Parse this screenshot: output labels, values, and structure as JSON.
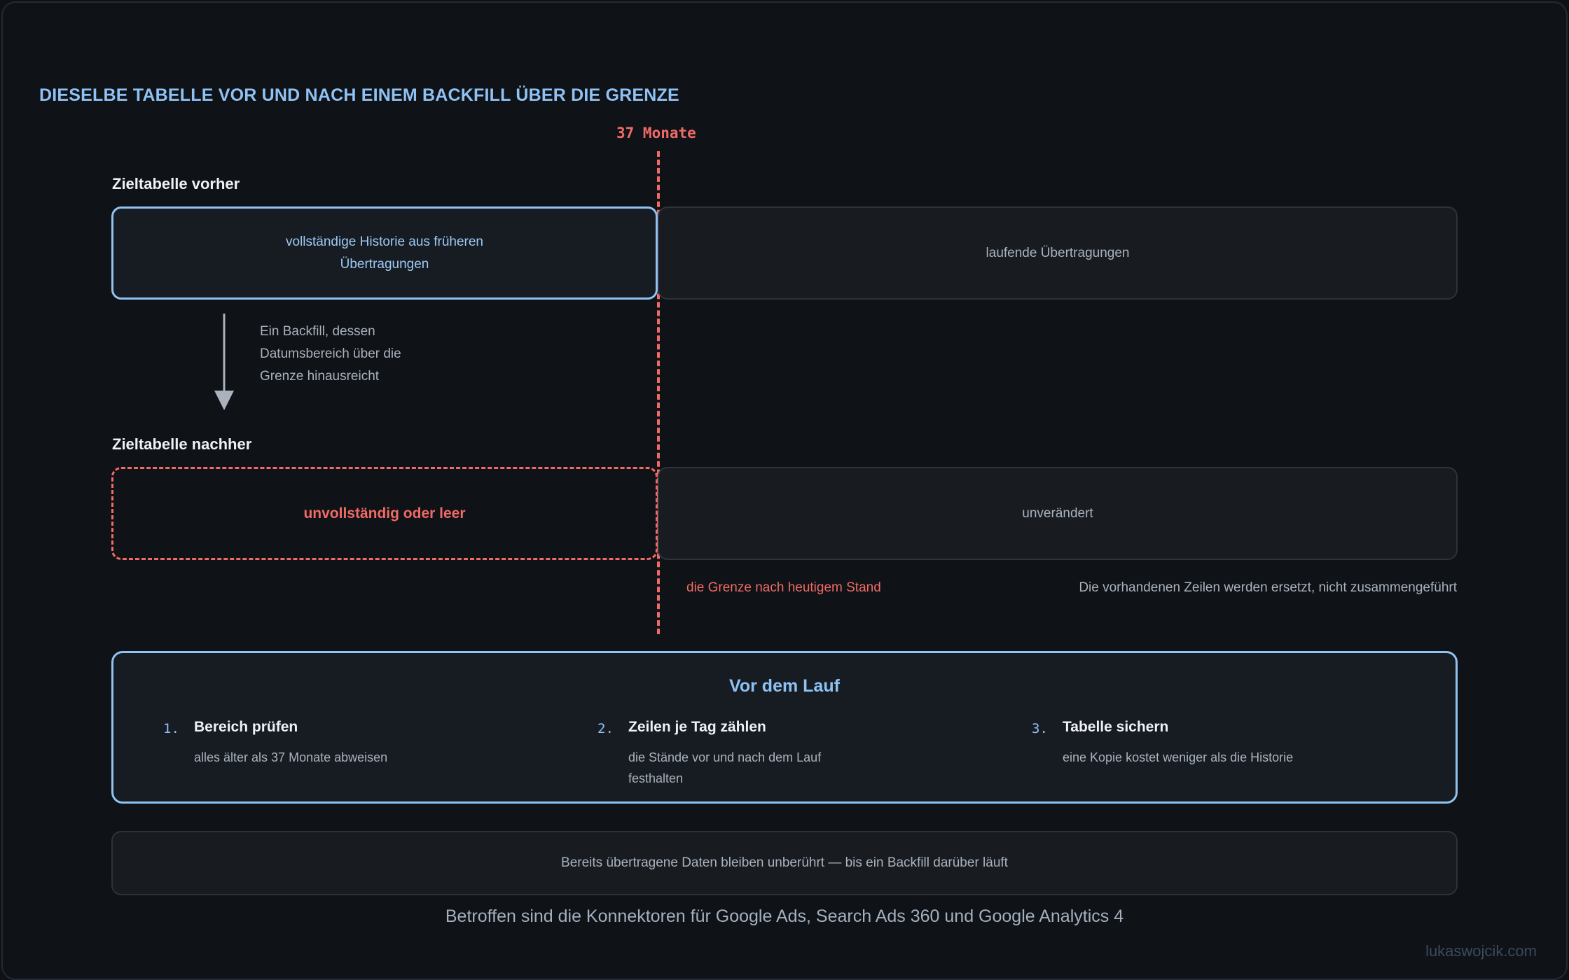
{
  "title": "DIESELBE TABELLE VOR UND NACH EINEM BACKFILL ÜBER DIE GRENZE",
  "boundary": {
    "label": "37 Monate",
    "note": "die Grenze nach heutigem Stand"
  },
  "before": {
    "label": "Zieltabelle vorher",
    "left_box_line1": "vollständige Historie aus früheren",
    "left_box_line2": "Übertragungen",
    "right_box": "laufende Übertragungen"
  },
  "transition": {
    "line1": "Ein Backfill, dessen",
    "line2": "Datumsbereich über die",
    "line3": "Grenze hinausreicht"
  },
  "after": {
    "label": "Zieltabelle nachher",
    "left_box": "unvollständig oder leer",
    "right_box": "unverändert",
    "note": "Die vorhandenen Zeilen werden ersetzt, nicht zusammengeführt"
  },
  "checklist": {
    "title": "Vor dem Lauf",
    "steps": [
      {
        "num": "1.",
        "title": "Bereich prüfen",
        "desc": "alles älter als 37 Monate abweisen"
      },
      {
        "num": "2.",
        "title": "Zeilen je Tag zählen",
        "desc": "die Stände vor und nach dem Lauf festhalten"
      },
      {
        "num": "3.",
        "title": "Tabelle sichern",
        "desc": "eine Kopie kostet weniger als die Historie"
      }
    ]
  },
  "footer_note": "Bereits übertragene Daten bleiben unberührt — bis ein Backfill darüber läuft",
  "caption": "Betroffen sind die Konnektoren für Google Ads, Search Ads 360 und Google Analytics 4",
  "watermark": "lukaswojcik.com",
  "colors": {
    "accent_blue": "#90c2f2",
    "accent_red": "#f06a66",
    "background": "#0f1216"
  }
}
